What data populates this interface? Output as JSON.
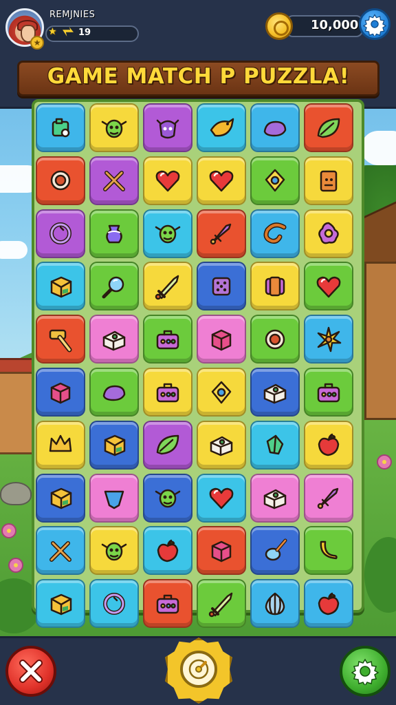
{
  "header": {
    "player_name": "REMJNIES",
    "level": "19",
    "coins": "10,000",
    "title": "GAME MATCH P PUZZLA!"
  },
  "colors": {
    "blue": "#3fb6ea",
    "yellow": "#f6d93c",
    "purple": "#b25ad6",
    "teal": "#3cc4e8",
    "red": "#e9522f",
    "green": "#6ccb3c",
    "pink": "#ef7fd3",
    "orange": "#f29a2e",
    "navy": "#3b6fd6",
    "lime": "#9fd63a"
  },
  "board": {
    "rows": [
      [
        {
          "c": "blue",
          "i": "box-icon"
        },
        {
          "c": "yellow",
          "i": "goblin-icon"
        },
        {
          "c": "purple",
          "i": "dragon-icon"
        },
        {
          "c": "teal",
          "i": "bird-icon"
        },
        {
          "c": "blue",
          "i": "blob-icon"
        },
        {
          "c": "red",
          "i": "leaf-icon"
        }
      ],
      [
        {
          "c": "red",
          "i": "ring-icon"
        },
        {
          "c": "purple",
          "i": "crossed-swords-icon"
        },
        {
          "c": "yellow",
          "i": "heart-icon"
        },
        {
          "c": "yellow",
          "i": "heart-icon"
        },
        {
          "c": "green",
          "i": "gem-icon"
        },
        {
          "c": "yellow",
          "i": "scroll-icon"
        }
      ],
      [
        {
          "c": "purple",
          "i": "swirl-icon"
        },
        {
          "c": "green",
          "i": "potion-icon"
        },
        {
          "c": "teal",
          "i": "goblin-icon"
        },
        {
          "c": "red",
          "i": "dagger-icon"
        },
        {
          "c": "blue",
          "i": "horn-icon"
        },
        {
          "c": "yellow",
          "i": "flower-icon"
        }
      ],
      [
        {
          "c": "teal",
          "i": "crate-icon"
        },
        {
          "c": "green",
          "i": "magnifier-icon"
        },
        {
          "c": "yellow",
          "i": "sword-icon"
        },
        {
          "c": "navy",
          "i": "dice-icon"
        },
        {
          "c": "yellow",
          "i": "barrel-icon"
        },
        {
          "c": "green",
          "i": "heart-icon"
        }
      ],
      [
        {
          "c": "red",
          "i": "hammer-icon"
        },
        {
          "c": "pink",
          "i": "chest-icon"
        },
        {
          "c": "green",
          "i": "bag-icon"
        },
        {
          "c": "pink",
          "i": "cube-icon"
        },
        {
          "c": "green",
          "i": "ring-icon"
        },
        {
          "c": "blue",
          "i": "star-icon"
        }
      ],
      [
        {
          "c": "navy",
          "i": "cube-icon"
        },
        {
          "c": "green",
          "i": "blob-icon"
        },
        {
          "c": "yellow",
          "i": "bag-icon"
        },
        {
          "c": "yellow",
          "i": "gem-icon"
        },
        {
          "c": "navy",
          "i": "chest-icon"
        },
        {
          "c": "green",
          "i": "bag-icon"
        }
      ],
      [
        {
          "c": "yellow",
          "i": "crown-icon"
        },
        {
          "c": "navy",
          "i": "crate-icon"
        },
        {
          "c": "purple",
          "i": "leaf-icon"
        },
        {
          "c": "yellow",
          "i": "chest-icon"
        },
        {
          "c": "teal",
          "i": "crystal-icon"
        },
        {
          "c": "yellow",
          "i": "apple-icon"
        }
      ],
      [
        {
          "c": "navy",
          "i": "crate-icon"
        },
        {
          "c": "pink",
          "i": "shield-icon"
        },
        {
          "c": "navy",
          "i": "goblin-icon"
        },
        {
          "c": "teal",
          "i": "heart-icon"
        },
        {
          "c": "pink",
          "i": "chest-icon"
        },
        {
          "c": "pink",
          "i": "dagger-icon"
        }
      ],
      [
        {
          "c": "blue",
          "i": "crossed-swords-icon"
        },
        {
          "c": "yellow",
          "i": "goblin-icon"
        },
        {
          "c": "teal",
          "i": "apple-icon"
        },
        {
          "c": "red",
          "i": "cube-icon"
        },
        {
          "c": "navy",
          "i": "spoon-icon"
        },
        {
          "c": "green",
          "i": "banana-icon"
        }
      ],
      [
        {
          "c": "teal",
          "i": "crate-icon"
        },
        {
          "c": "teal",
          "i": "swirl-icon"
        },
        {
          "c": "red",
          "i": "bag-icon"
        },
        {
          "c": "green",
          "i": "sword-icon"
        },
        {
          "c": "blue",
          "i": "onion-icon"
        },
        {
          "c": "blue",
          "i": "apple-icon"
        }
      ]
    ]
  }
}
